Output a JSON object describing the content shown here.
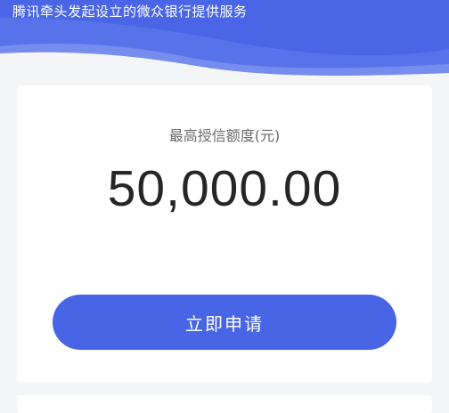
{
  "header": {
    "tagline": "腾讯牵头发起设立的微众银行提供服务"
  },
  "credit_card": {
    "limit_label": "最高授信额度(元)",
    "limit_amount": "50,000.00",
    "apply_button_label": "立即申请"
  },
  "colors": {
    "header_blue": "#4a66e6",
    "button_blue": "#4765e5",
    "page_background": "#f4f5f7"
  }
}
